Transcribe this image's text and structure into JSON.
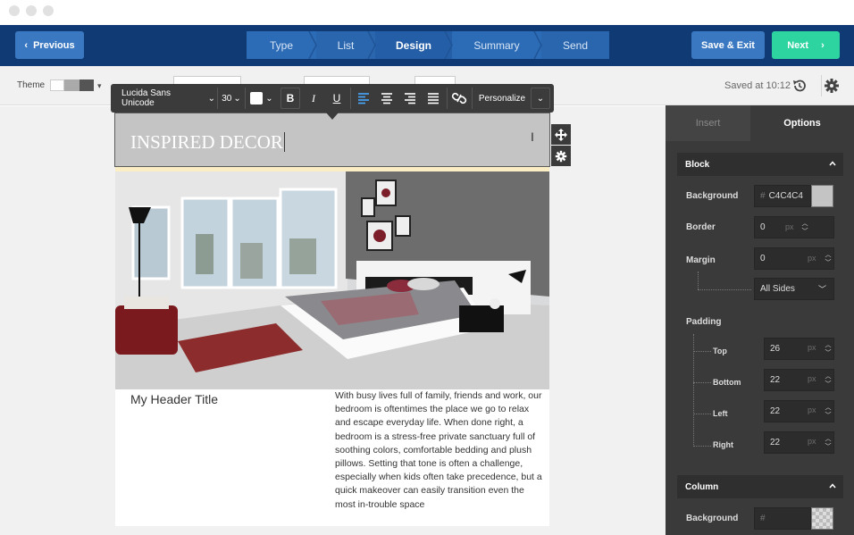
{
  "nav": {
    "previous_label": "Previous",
    "steps": [
      {
        "label": "Type"
      },
      {
        "label": "List"
      },
      {
        "label": "Design"
      },
      {
        "label": "Summary"
      },
      {
        "label": "Send"
      }
    ],
    "active_step": "Design",
    "save_exit_label": "Save & Exit",
    "next_label": "Next"
  },
  "toolbar": {
    "theme_label": "Theme",
    "saved_text": "Saved at 10:12"
  },
  "format_bar": {
    "font": "Lucida Sans Unicode",
    "size": "30",
    "bold": "B",
    "italic": "I",
    "underline": "U",
    "personalize": "Personalize"
  },
  "email": {
    "header_text": "INSPIRED DECOR",
    "column_title": "My Header Title",
    "column_body": "With busy lives full of family, friends and work, our bedroom is oftentimes the place we go to relax and escape everyday life. When done right, a bedroom is a stress-free private sanctuary full of soothing colors, comfortable bedding and plush pillows. Setting that tone is often a challenge, especially when kids often take precedence, but a quick makeover can easily transition even the most in-trouble space"
  },
  "panel": {
    "tab_insert": "Insert",
    "tab_options": "Options",
    "block": {
      "title": "Block",
      "background_label": "Background",
      "background_hash": "#",
      "background_value": "C4C4C4",
      "background_color": "#c4c4c4",
      "border_label": "Border",
      "border_value": "0",
      "border_unit": "px",
      "margin_label": "Margin",
      "margin_value": "0",
      "margin_unit": "px",
      "margin_sides": "All Sides",
      "padding_label": "Padding",
      "padding": [
        {
          "label": "Top",
          "value": "26",
          "unit": "px"
        },
        {
          "label": "Bottom",
          "value": "22",
          "unit": "px"
        },
        {
          "label": "Left",
          "value": "22",
          "unit": "px"
        },
        {
          "label": "Right",
          "value": "22",
          "unit": "px"
        }
      ]
    },
    "column": {
      "title": "Column",
      "background_label": "Background",
      "background_hash": "#"
    }
  },
  "colors": {
    "nav_bg": "#0f3a73",
    "step_bg": "#2c6bb5",
    "step_active_bg": "#245ea6",
    "next_bg": "#2dd4a0",
    "panel_bg": "#3a3a3a",
    "header_block_bg": "#c4c4c4"
  }
}
